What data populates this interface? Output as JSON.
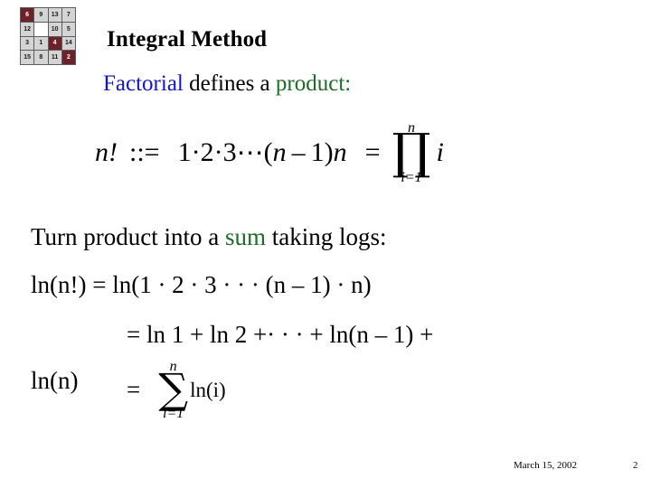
{
  "slide": {
    "title": "Integral Method",
    "footer": {
      "date": "March 15, 2002",
      "page_number": "2"
    }
  },
  "puzzle_icon": {
    "name": "fifteen-puzzle-grid",
    "rows": 4,
    "cols": 4,
    "colors": {
      "tile_gray": "#d4d4d4",
      "tile_maroon": "#6d2128",
      "blank": "#ffffff",
      "border": "#5d5d5d"
    },
    "cells": [
      {
        "label": "6",
        "style": "maroon"
      },
      {
        "label": "9",
        "style": "gray"
      },
      {
        "label": "13",
        "style": "gray"
      },
      {
        "label": "7",
        "style": "gray"
      },
      {
        "label": "12",
        "style": "gray"
      },
      {
        "label": "",
        "style": "blank"
      },
      {
        "label": "10",
        "style": "gray"
      },
      {
        "label": "5",
        "style": "gray"
      },
      {
        "label": "3",
        "style": "gray"
      },
      {
        "label": "1",
        "style": "gray"
      },
      {
        "label": "4",
        "style": "maroon"
      },
      {
        "label": "14",
        "style": "gray"
      },
      {
        "label": "15",
        "style": "gray"
      },
      {
        "label": "8",
        "style": "gray"
      },
      {
        "label": "11",
        "style": "gray"
      },
      {
        "label": "2",
        "style": "maroon"
      }
    ]
  },
  "subtitle": {
    "word_factorial": "Factorial",
    "word_defines": "defines a",
    "word_product": "product:",
    "color_factorial": "#1414c8",
    "color_product": "#1d6b28"
  },
  "equation_product": {
    "lhs_n": "n",
    "lhs_bang": "!",
    "assign": "::=",
    "term_1": "1",
    "dot_1": "·",
    "term_2": "2",
    "dot_2": "·",
    "term_3": "3",
    "ellipsis": "⋯",
    "open_paren": "(",
    "var_n": "n",
    "minus": "–",
    "one": "1",
    "close_paren": ")",
    "trailing_n": "n",
    "equals": "=",
    "prod_symbol": "∏",
    "prod_upper": "n",
    "prod_lower": "i=1",
    "prod_operand": "i"
  },
  "body_line": {
    "part_turn": "Turn product into a ",
    "part_sum": "sum",
    "part_rest": " taking logs:",
    "color_sum": "#1d6b28"
  },
  "equation_logs": {
    "line1": "ln(n!)  =  ln(1 · 2 · 3 · · · (n – 1) · n)",
    "line2": "=  ln 1 + ln 2 +· · · + ln(n – 1) +",
    "line3_lhs": "ln(n)",
    "line3_equals": "=",
    "sum_symbol": "∑",
    "sum_upper": "n",
    "sum_lower": "i=1",
    "sum_operand": "ln(i)"
  }
}
